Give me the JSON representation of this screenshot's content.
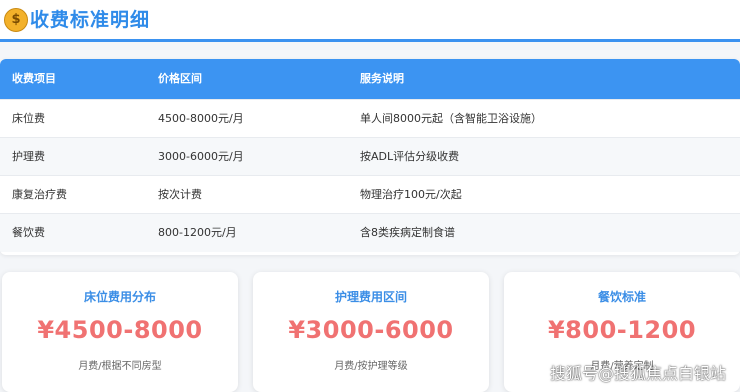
{
  "header": {
    "icon": "money-bag-icon",
    "title": "收费标准明细"
  },
  "table": {
    "columns": [
      "收费项目",
      "价格区间",
      "服务说明"
    ],
    "rows": [
      [
        "床位费",
        "4500-8000元/月",
        "单人间8000元起（含智能卫浴设施）"
      ],
      [
        "护理费",
        "3000-6000元/月",
        "按ADL评估分级收费"
      ],
      [
        "康复治疗费",
        "按次计费",
        "物理治疗100元/次起"
      ],
      [
        "餐饮费",
        "800-1200元/月",
        "含8类疾病定制食谱"
      ]
    ]
  },
  "cards": [
    {
      "title": "床位费用分布",
      "price": "¥4500-8000",
      "note": "月费/根据不同房型"
    },
    {
      "title": "护理费用区间",
      "price": "¥3000-6000",
      "note": "月费/按护理等级"
    },
    {
      "title": "餐饮标准",
      "price": "¥800-1200",
      "note": "月费/营养定制"
    }
  ],
  "watermark": "搜狐号@搜狐焦点白银站",
  "colors": {
    "accent": "#3c94f2",
    "price": "#f07272"
  }
}
